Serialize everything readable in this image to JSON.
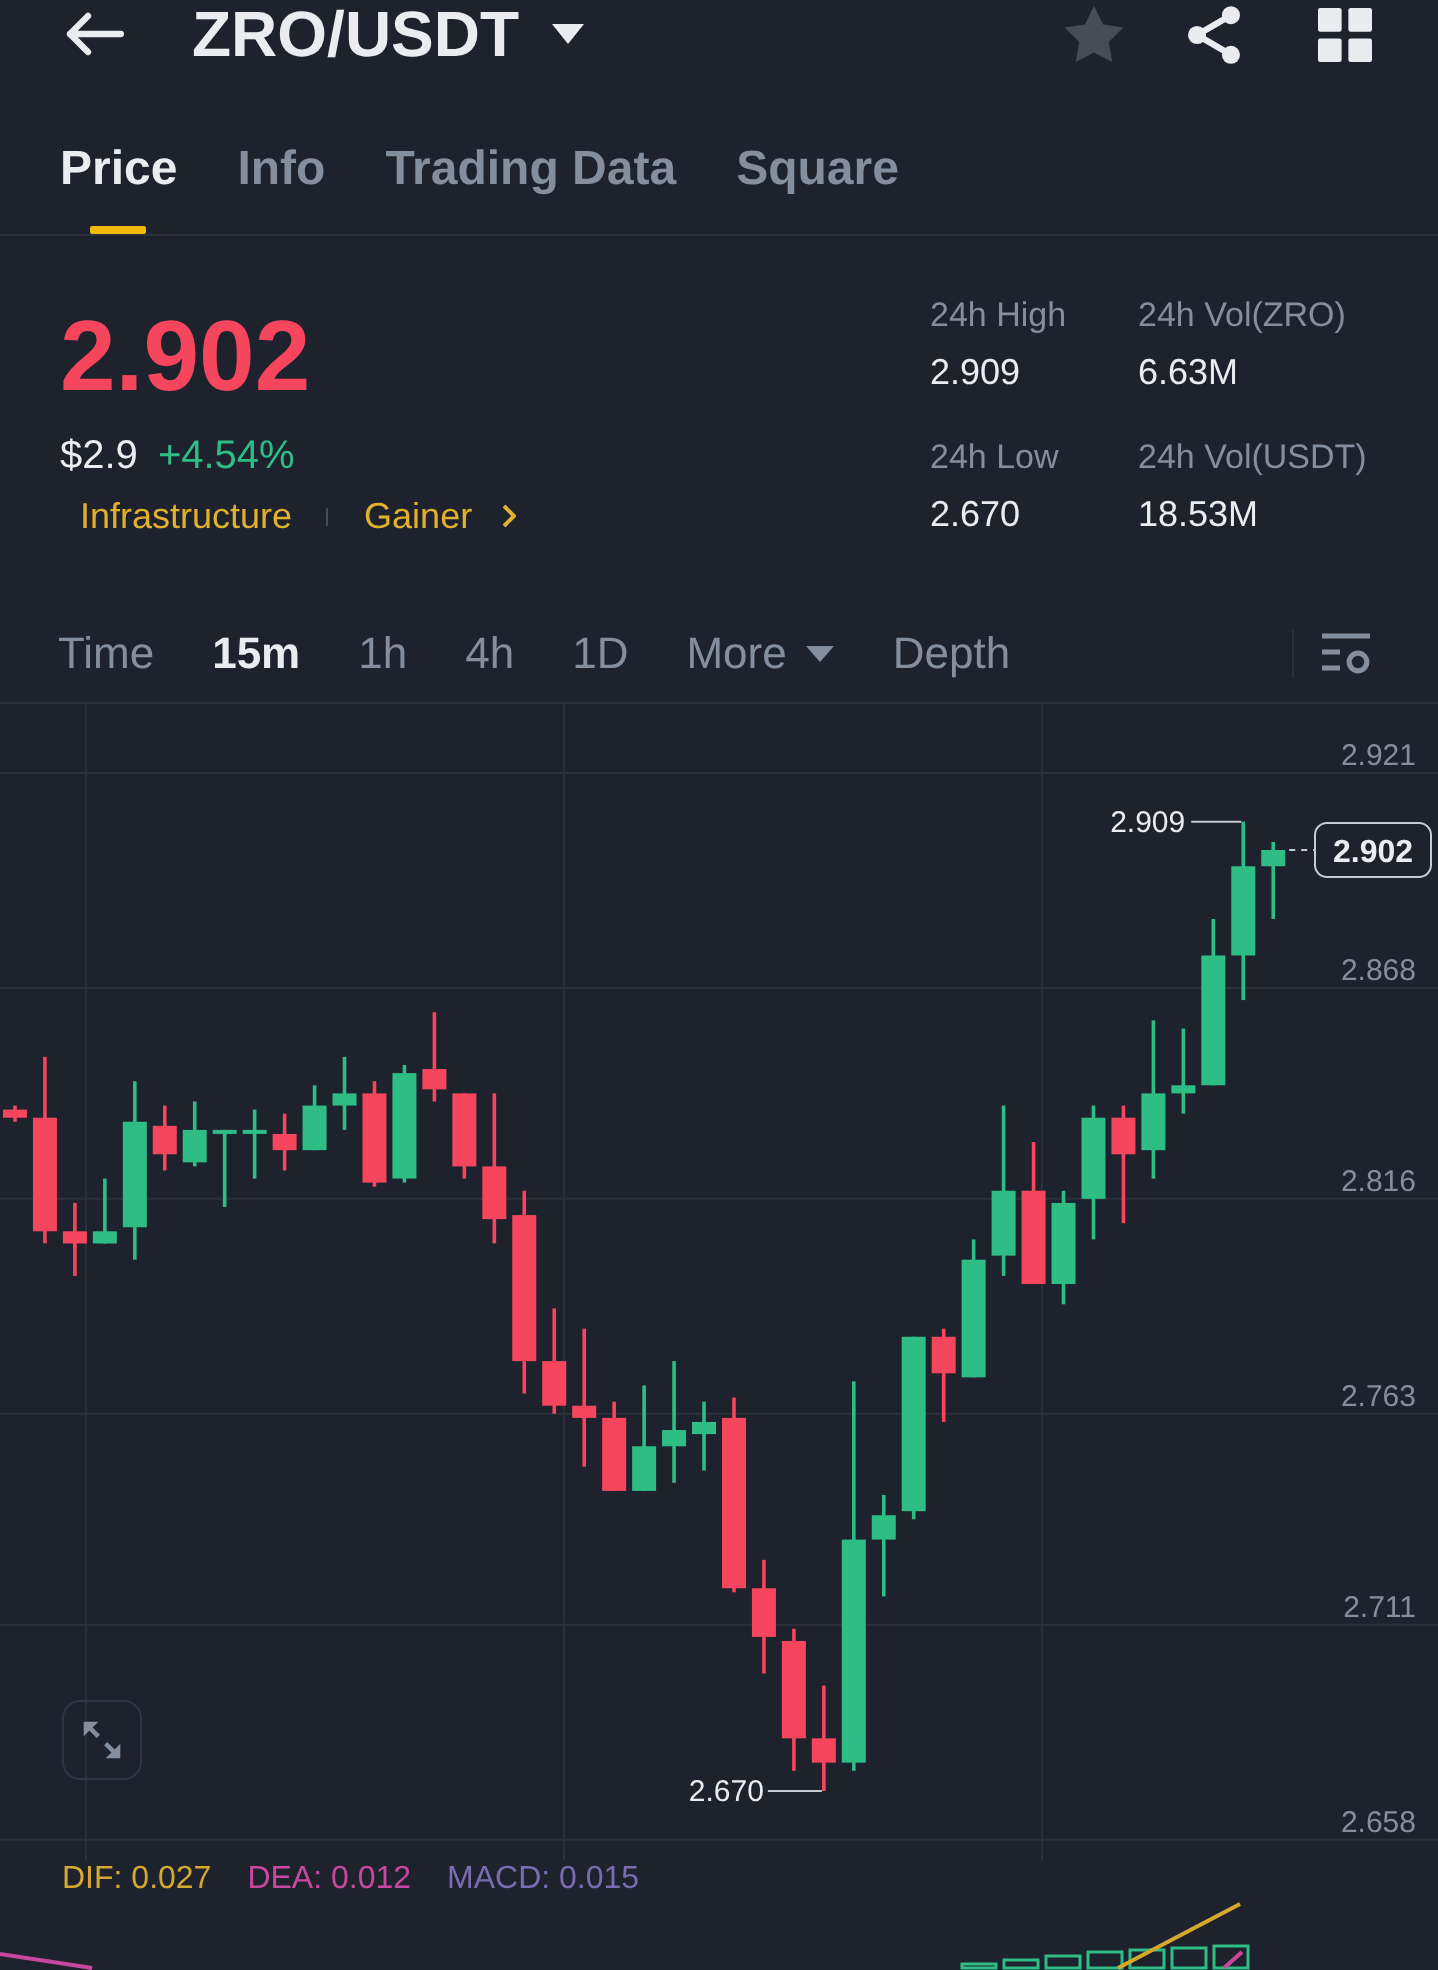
{
  "header": {
    "title": "ZRO/USDT",
    "favorite": false
  },
  "tabs": [
    {
      "label": "Price",
      "selected": true
    },
    {
      "label": "Info",
      "selected": false
    },
    {
      "label": "Trading Data",
      "selected": false
    },
    {
      "label": "Square",
      "selected": false
    }
  ],
  "ticker": {
    "last_price": {
      "value": "2.902",
      "rising": false
    },
    "usd_price": "$2.9",
    "change": {
      "value": "+4.54%",
      "rising": true
    }
  },
  "tags": [
    {
      "label": "Infrastructure",
      "kind": "category"
    },
    {
      "label": "Gainer",
      "kind": "link"
    }
  ],
  "stats": [
    {
      "label": "24h High",
      "value": "2.909"
    },
    {
      "label": "24h Vol(ZRO)",
      "value": "6.63M"
    },
    {
      "label": "24h Low",
      "value": "2.670"
    },
    {
      "label": "24h Vol(USDT)",
      "value": "18.53M"
    }
  ],
  "intervals": [
    {
      "label": "Time",
      "kind": "option",
      "selected": false
    },
    {
      "label": "15m",
      "kind": "option",
      "selected": true
    },
    {
      "label": "1h",
      "kind": "option",
      "selected": false
    },
    {
      "label": "4h",
      "kind": "option",
      "selected": false
    },
    {
      "label": "1D",
      "kind": "option",
      "selected": false
    },
    {
      "label": "More",
      "kind": "dropdown",
      "selected": false
    },
    {
      "label": "Depth",
      "kind": "option",
      "selected": false
    }
  ],
  "chart": {
    "chart_data": {
      "type": "candlestick",
      "categories": [
        null,
        null,
        null,
        null,
        null,
        null,
        null,
        null,
        null,
        null,
        null,
        null,
        null,
        null,
        null,
        null,
        null,
        null,
        null,
        null,
        null,
        null,
        null,
        null,
        null,
        null,
        null,
        null,
        null,
        null,
        null,
        null,
        null,
        null,
        null,
        null,
        null,
        null,
        null,
        null,
        null,
        null,
        null,
        null,
        null,
        null,
        null,
        null
      ],
      "ohlc": [
        [
          2.838,
          2.839,
          2.835,
          2.836
        ],
        [
          2.836,
          2.851,
          2.805,
          2.808
        ],
        [
          2.808,
          2.815,
          2.797,
          2.805
        ],
        [
          2.805,
          2.821,
          2.805,
          2.808
        ],
        [
          2.809,
          2.845,
          2.801,
          2.835
        ],
        [
          2.834,
          2.839,
          2.823,
          2.827
        ],
        [
          2.825,
          2.84,
          2.824,
          2.833
        ],
        [
          2.832,
          2.833,
          2.814,
          2.833
        ],
        [
          2.832,
          2.838,
          2.821,
          2.833
        ],
        [
          2.832,
          2.837,
          2.823,
          2.828
        ],
        [
          2.828,
          2.844,
          2.828,
          2.839
        ],
        [
          2.839,
          2.851,
          2.833,
          2.842
        ],
        [
          2.842,
          2.845,
          2.819,
          2.82
        ],
        [
          2.821,
          2.849,
          2.82,
          2.847
        ],
        [
          2.848,
          2.862,
          2.84,
          2.843
        ],
        [
          2.842,
          2.842,
          2.821,
          2.824
        ],
        [
          2.824,
          2.842,
          2.805,
          2.811
        ],
        [
          2.812,
          2.818,
          2.768,
          2.776
        ],
        [
          2.776,
          2.789,
          2.763,
          2.765
        ],
        [
          2.765,
          2.784,
          2.75,
          2.762
        ],
        [
          2.762,
          2.766,
          2.744,
          2.744
        ],
        [
          2.744,
          2.77,
          2.744,
          2.755
        ],
        [
          2.755,
          2.776,
          2.746,
          2.759
        ],
        [
          2.758,
          2.766,
          2.749,
          2.761
        ],
        [
          2.762,
          2.767,
          2.719,
          2.72
        ],
        [
          2.72,
          2.727,
          2.699,
          2.708
        ],
        [
          2.707,
          2.71,
          2.675,
          2.683
        ],
        [
          2.683,
          2.696,
          2.67,
          2.677
        ],
        [
          2.677,
          2.771,
          2.675,
          2.732
        ],
        [
          2.732,
          2.743,
          2.718,
          2.738
        ],
        [
          2.739,
          2.782,
          2.737,
          2.782
        ],
        [
          2.782,
          2.784,
          2.761,
          2.773
        ],
        [
          2.772,
          2.806,
          2.772,
          2.801
        ],
        [
          2.802,
          2.839,
          2.797,
          2.818
        ],
        [
          2.818,
          2.83,
          2.795,
          2.795
        ],
        [
          2.795,
          2.818,
          2.79,
          2.815
        ],
        [
          2.816,
          2.839,
          2.806,
          2.836
        ],
        [
          2.836,
          2.839,
          2.81,
          2.827
        ],
        [
          2.828,
          2.86,
          2.821,
          2.842
        ],
        [
          2.842,
          2.858,
          2.837,
          2.844
        ],
        [
          2.844,
          2.885,
          2.844,
          2.876
        ],
        [
          2.876,
          2.909,
          2.865,
          2.898
        ],
        [
          2.898,
          2.904,
          2.885,
          2.902
        ],
        null,
        null,
        null,
        null,
        null
      ],
      "ylim": [
        2.653,
        2.938
      ],
      "yticks": [
        {
          "value": 2.921,
          "label": "2.921"
        },
        {
          "value": 2.868,
          "label": "2.868"
        },
        {
          "value": 2.816,
          "label": "2.816"
        },
        {
          "value": 2.763,
          "label": "2.763"
        },
        {
          "value": 2.711,
          "label": "2.711"
        },
        {
          "value": 2.658,
          "label": "2.658"
        }
      ],
      "grid": true
    },
    "high_marker": "2.909",
    "low_marker": "2.670",
    "current_price": "2.902"
  },
  "indicators": [
    {
      "label": "DIF: 0.027",
      "color": "#d6a92e"
    },
    {
      "label": "DEA: 0.012",
      "color": "#c8479f"
    },
    {
      "label": "MACD: 0.015",
      "color": "#7b6bb0"
    }
  ]
}
